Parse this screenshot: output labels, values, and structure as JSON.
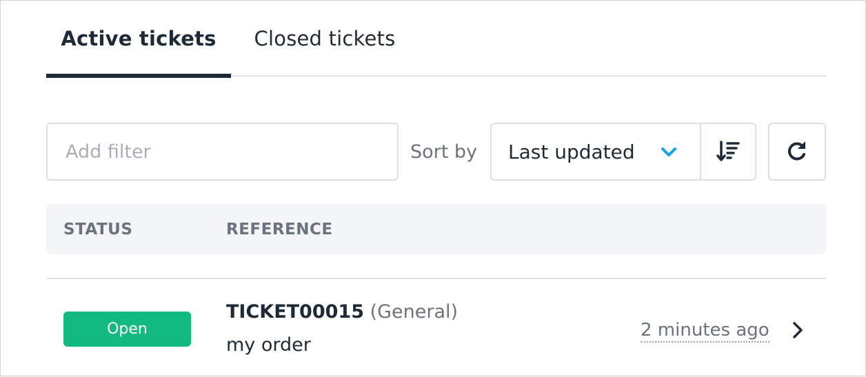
{
  "tabs": {
    "active_label": "Active tickets",
    "closed_label": "Closed tickets"
  },
  "toolbar": {
    "filter_placeholder": "Add filter",
    "sort_label": "Sort by",
    "sort_value": "Last updated",
    "chevron_icon": "chevron-down-icon",
    "sort_direction_icon": "sort-descending-icon",
    "refresh_icon": "refresh-icon"
  },
  "table": {
    "columns": [
      "STATUS",
      "REFERENCE"
    ],
    "rows": [
      {
        "status": "Open",
        "reference": "TICKET00015",
        "category": "(General)",
        "subject": "my order",
        "updated": "2 minutes ago"
      }
    ]
  },
  "colors": {
    "accent": "#0ea5e9",
    "status_open": "#12b981",
    "tab_underline": "#1f2a37",
    "header_bg": "#f4f5f7"
  }
}
